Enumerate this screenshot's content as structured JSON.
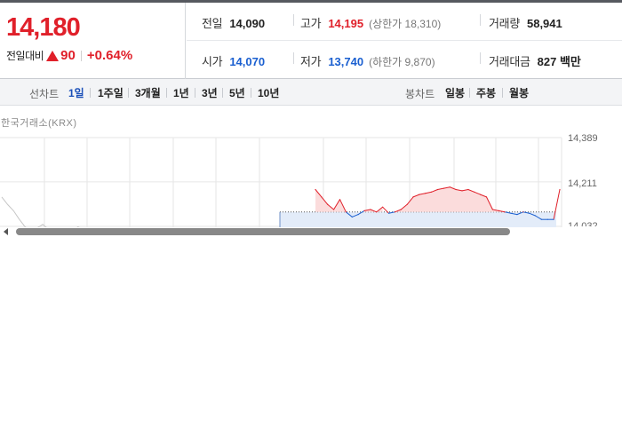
{
  "summary": {
    "price": "14,180",
    "change_label": "전일대비",
    "change_value": "90",
    "change_percent": "+0.64%",
    "row1": {
      "prev_label": "전일",
      "prev_value": "14,090",
      "high_label": "고가",
      "high_value": "14,195",
      "upper_limit": "(상한가 18,310)",
      "volume_label": "거래량",
      "volume_value": "58,941"
    },
    "row2": {
      "open_label": "시가",
      "open_value": "14,070",
      "low_label": "저가",
      "low_value": "13,740",
      "lower_limit": "(하한가 9,870)",
      "amount_label": "거래대금",
      "amount_value": "827 백만"
    }
  },
  "toolbar": {
    "line_label": "선차트",
    "line_periods": [
      "1일",
      "1주일",
      "3개월",
      "1년",
      "3년",
      "5년",
      "10년"
    ],
    "active_period": "1일",
    "candle_label": "봉차트",
    "candle_periods": [
      "일봉",
      "주봉",
      "월봉"
    ]
  },
  "chart": {
    "source": "한국거래소(KRX)",
    "y_ticks": [
      "14,389",
      "14,211",
      "14,032"
    ]
  },
  "chart_data": {
    "type": "line",
    "title": "",
    "xlabel": "",
    "ylabel": "",
    "reference_price": 14090,
    "ylim": [
      14032,
      14389
    ],
    "y_ticks": [
      14389,
      14211,
      14032
    ],
    "grid": true,
    "series": [
      {
        "values": [
          14180,
          14150,
          14120,
          14100,
          14140,
          14090,
          14070,
          14080,
          14095,
          14100,
          14090,
          14110,
          14085,
          14090,
          14100,
          14120,
          14150,
          14160,
          14165,
          14170,
          14180,
          14185,
          14190,
          14180,
          14175,
          14180,
          14170,
          14160,
          14150,
          14100,
          14095,
          14090,
          14085,
          14080,
          14090,
          14085,
          14075,
          14060,
          14060,
          14060,
          14180
        ]
      }
    ],
    "colors": {
      "up": "#e0202a",
      "down": "#1a5fd0",
      "prev_day": "#c6c6c6"
    }
  }
}
